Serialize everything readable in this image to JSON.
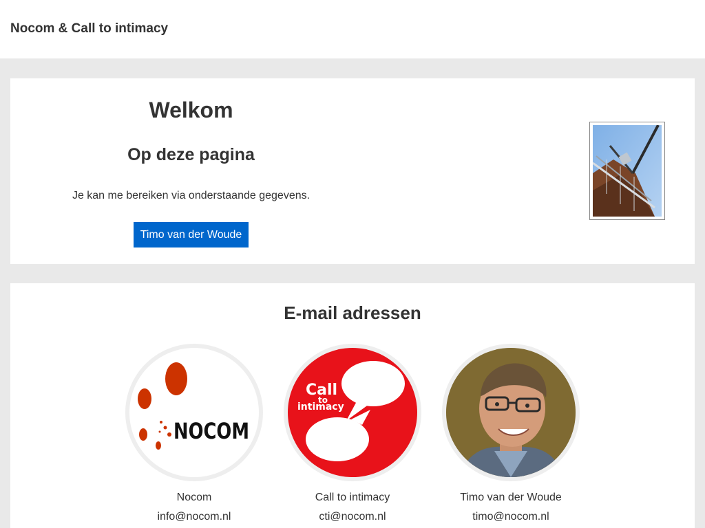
{
  "header": {
    "site_title": "Nocom & Call to intimacy"
  },
  "welcome": {
    "title": "Welkom",
    "subtitle": "Op deze pagina",
    "text": "Je kan me bereiken via onderstaande gegevens.",
    "button_label": "Timo van der Woude",
    "photo": "windmill-photo"
  },
  "emails": {
    "heading": "E-mail adressen",
    "contacts": [
      {
        "name": "Nocom",
        "email": "info@nocom.nl",
        "logo_text": "NOCOM",
        "image": "nocom-logo"
      },
      {
        "name": "Call to intimacy",
        "email": "cti@nocom.nl",
        "logo_text": [
          "Call",
          "to",
          "intimacy"
        ],
        "image": "call-to-intimacy-logo"
      },
      {
        "name": "Timo van der Woude",
        "email": "timo@nocom.nl",
        "image": "portrait-photo"
      }
    ]
  },
  "colors": {
    "button": "#0066cc",
    "background": "#e9e9e9",
    "nocom_dots": "#cc3300",
    "cti_red": "#e8121a"
  }
}
